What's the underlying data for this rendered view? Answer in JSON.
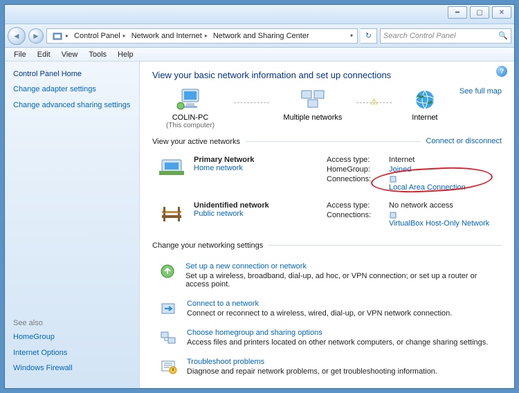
{
  "breadcrumb": [
    "Control Panel",
    "Network and Internet",
    "Network and Sharing Center"
  ],
  "search_placeholder": "Search Control Panel",
  "menus": [
    "File",
    "Edit",
    "View",
    "Tools",
    "Help"
  ],
  "sidebar": {
    "home": "Control Panel Home",
    "links": [
      "Change adapter settings",
      "Change advanced sharing settings"
    ],
    "seealso_label": "See also",
    "seealso": [
      "HomeGroup",
      "Internet Options",
      "Windows Firewall"
    ]
  },
  "main": {
    "heading": "View your basic network information and set up connections",
    "fullmap": "See full map",
    "nodes": {
      "pc": "COLIN-PC",
      "pc_sub": "(This computer)",
      "multi": "Multiple networks",
      "internet": "Internet"
    },
    "active_label": "View your active networks",
    "connect_link": "Connect or disconnect",
    "networks": [
      {
        "name": "Primary Network",
        "type": "Home network",
        "rows": [
          [
            "Access type:",
            "Internet",
            false
          ],
          [
            "HomeGroup:",
            "Joined",
            true
          ],
          [
            "Connections:",
            "Local Area Connection",
            true
          ]
        ]
      },
      {
        "name": "Unidentified network",
        "type": "Public network",
        "rows": [
          [
            "Access type:",
            "No network access",
            false
          ],
          [
            "Connections:",
            "VirtualBox Host-Only Network",
            true
          ]
        ]
      }
    ],
    "change_label": "Change your networking settings",
    "tasks": [
      {
        "title": "Set up a new connection or network",
        "desc": "Set up a wireless, broadband, dial-up, ad hoc, or VPN connection; or set up a router or access point."
      },
      {
        "title": "Connect to a network",
        "desc": "Connect or reconnect to a wireless, wired, dial-up, or VPN network connection."
      },
      {
        "title": "Choose homegroup and sharing options",
        "desc": "Access files and printers located on other network computers, or change sharing settings."
      },
      {
        "title": "Troubleshoot problems",
        "desc": "Diagnose and repair network problems, or get troubleshooting information."
      }
    ]
  }
}
